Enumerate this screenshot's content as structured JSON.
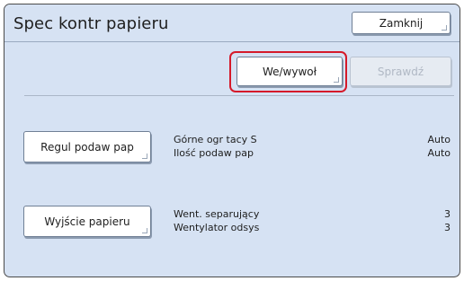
{
  "window": {
    "title": "Spec kontr papieru"
  },
  "header": {
    "close_label": "Zamknij"
  },
  "toolbar": {
    "input_output_label": "We/wywoł",
    "check_label": "Sprawdź"
  },
  "rows": [
    {
      "button_label": "Regul podaw pap",
      "settings": [
        {
          "label": "Górne ogr tacy S",
          "value": "Auto"
        },
        {
          "label": "Ilość podaw pap",
          "value": "Auto"
        }
      ]
    },
    {
      "button_label": "Wyjście papieru",
      "settings": [
        {
          "label": "Went. separujący",
          "value": "3"
        },
        {
          "label": "Wentylator odsys",
          "value": "3"
        }
      ]
    }
  ],
  "colors": {
    "panel_bg": "#d6e2f3",
    "highlight": "#d51a2a",
    "disabled_text": "#b0b8c4"
  }
}
